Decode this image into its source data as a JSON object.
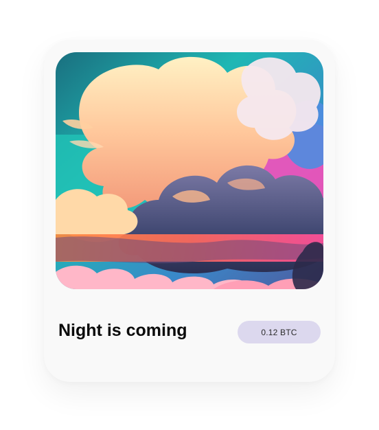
{
  "card": {
    "title": "Night is coming",
    "price": "0.12 BTC",
    "image_description": "painted-sunset-clouds"
  },
  "colors": {
    "card_background": "#f9f9f9",
    "price_badge": "#dcd8ee",
    "title_text": "#0b0b0b"
  }
}
